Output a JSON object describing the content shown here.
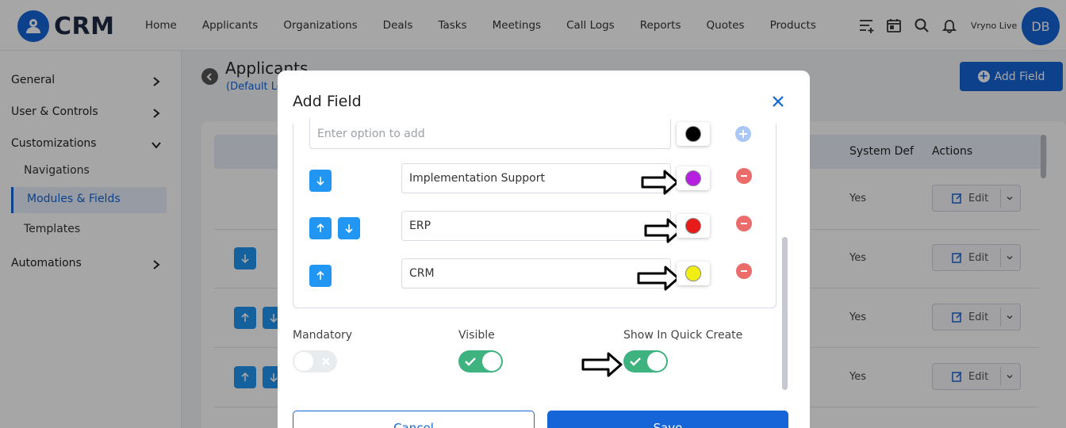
{
  "app": {
    "logo_text": "CRM",
    "account_name": "Vryno Live",
    "avatar_initials": "DB"
  },
  "nav": [
    "Home",
    "Applicants",
    "Organizations",
    "Deals",
    "Tasks",
    "Meetings",
    "Call Logs",
    "Reports",
    "Quotes",
    "Products"
  ],
  "sidebar": {
    "general": "General",
    "user_controls": "User & Controls",
    "customizations": "Customizations",
    "navigations": "Navigations",
    "modules_fields": "Modules & Fields",
    "templates": "Templates",
    "automations": "Automations"
  },
  "page": {
    "title": "Applicants",
    "subtitle": "(Default Lo",
    "add_field_label": "Add Field"
  },
  "table": {
    "headers": {
      "system_def": "System Def",
      "actions": "Actions"
    },
    "rows": [
      {
        "system_def": "Yes",
        "action_label": "Edit"
      },
      {
        "system_def": "Yes",
        "action_label": "Edit"
      },
      {
        "system_def": "Yes",
        "action_label": "Edit"
      },
      {
        "system_def": "Yes",
        "action_label": "Edit"
      }
    ]
  },
  "modal": {
    "title": "Add Field",
    "option_placeholder": "Enter option to add",
    "new_option_color": "#000000",
    "options": [
      {
        "label": "Implementation Support",
        "color": "#b41fe0"
      },
      {
        "label": "ERP",
        "color": "#e81b1b"
      },
      {
        "label": "CRM",
        "color": "#f2ee14"
      }
    ],
    "toggles": [
      {
        "label": "Mandatory",
        "state": "off"
      },
      {
        "label": "Visible",
        "state": "on"
      },
      {
        "label": "Show In Quick Create",
        "state": "on"
      }
    ],
    "cancel_label": "Cancel",
    "save_label": "Save"
  },
  "colors": {
    "primary": "#1565d8",
    "toggle_on": "#3fb37f",
    "remove": "#ec6b6b",
    "arrow_btn": "#2196f3"
  }
}
